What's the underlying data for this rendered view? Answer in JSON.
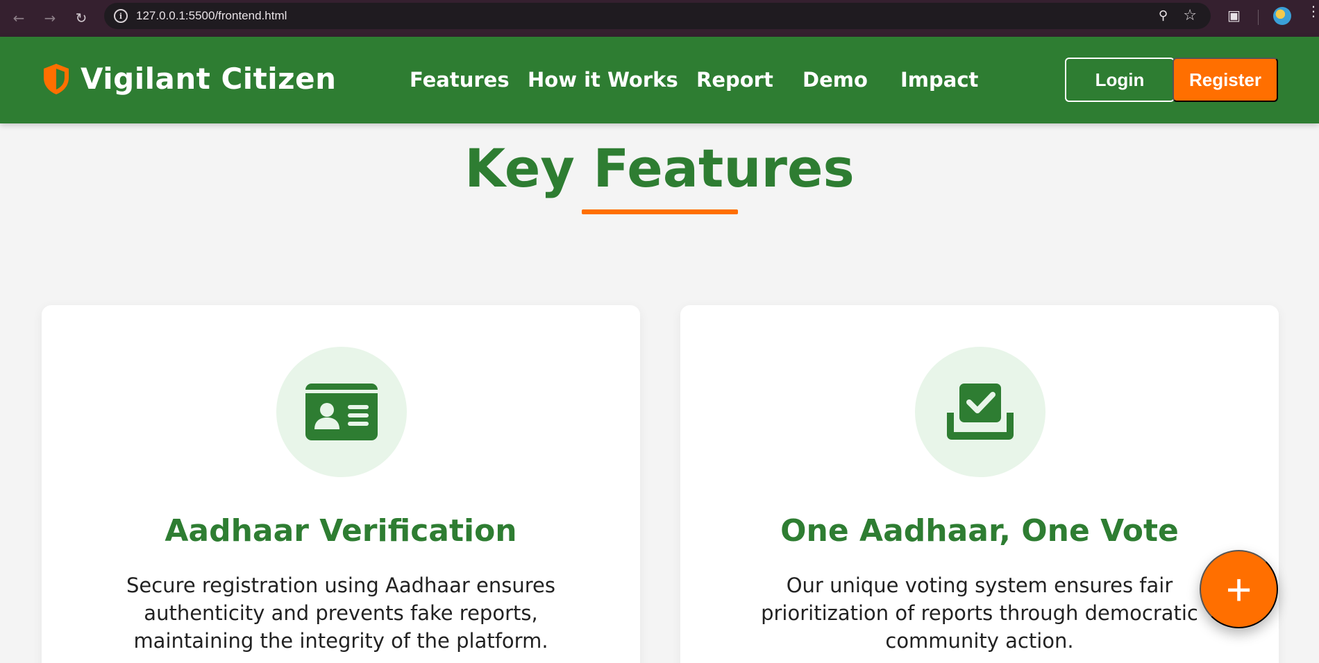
{
  "browser": {
    "url": "127.0.0.1:5500/frontend.html"
  },
  "header": {
    "brand": "Vigilant Citizen",
    "nav": [
      "Features",
      "How it Works",
      "Report",
      "Demo",
      "Impact"
    ],
    "login_label": "Login",
    "register_label": "Register"
  },
  "section": {
    "title": "Key Features"
  },
  "cards": [
    {
      "icon": "id-card-icon",
      "title": "Aadhaar Verification",
      "description": "Secure registration using Aadhaar ensures authenticity and prevents fake reports, maintaining the integrity of the platform."
    },
    {
      "icon": "vote-box-icon",
      "title": "One Aadhaar, One Vote",
      "description": "Our unique voting system ensures fair prioritization of reports through democratic community action."
    }
  ],
  "fab": {
    "label": "+"
  },
  "colors": {
    "primary": "#2e7d32",
    "accent": "#ff6f00",
    "icon_bg": "#e8f5e9"
  }
}
